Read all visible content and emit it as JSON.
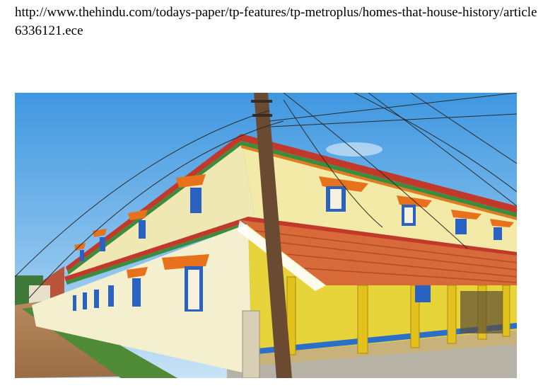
{
  "article": {
    "url": "http://www.thehindu.com/todays-paper/tp-features/tp-metroplus/homes-that-house-history/article6336121.ece"
  },
  "photo": {
    "subject": "two-storey-heritage-house"
  }
}
